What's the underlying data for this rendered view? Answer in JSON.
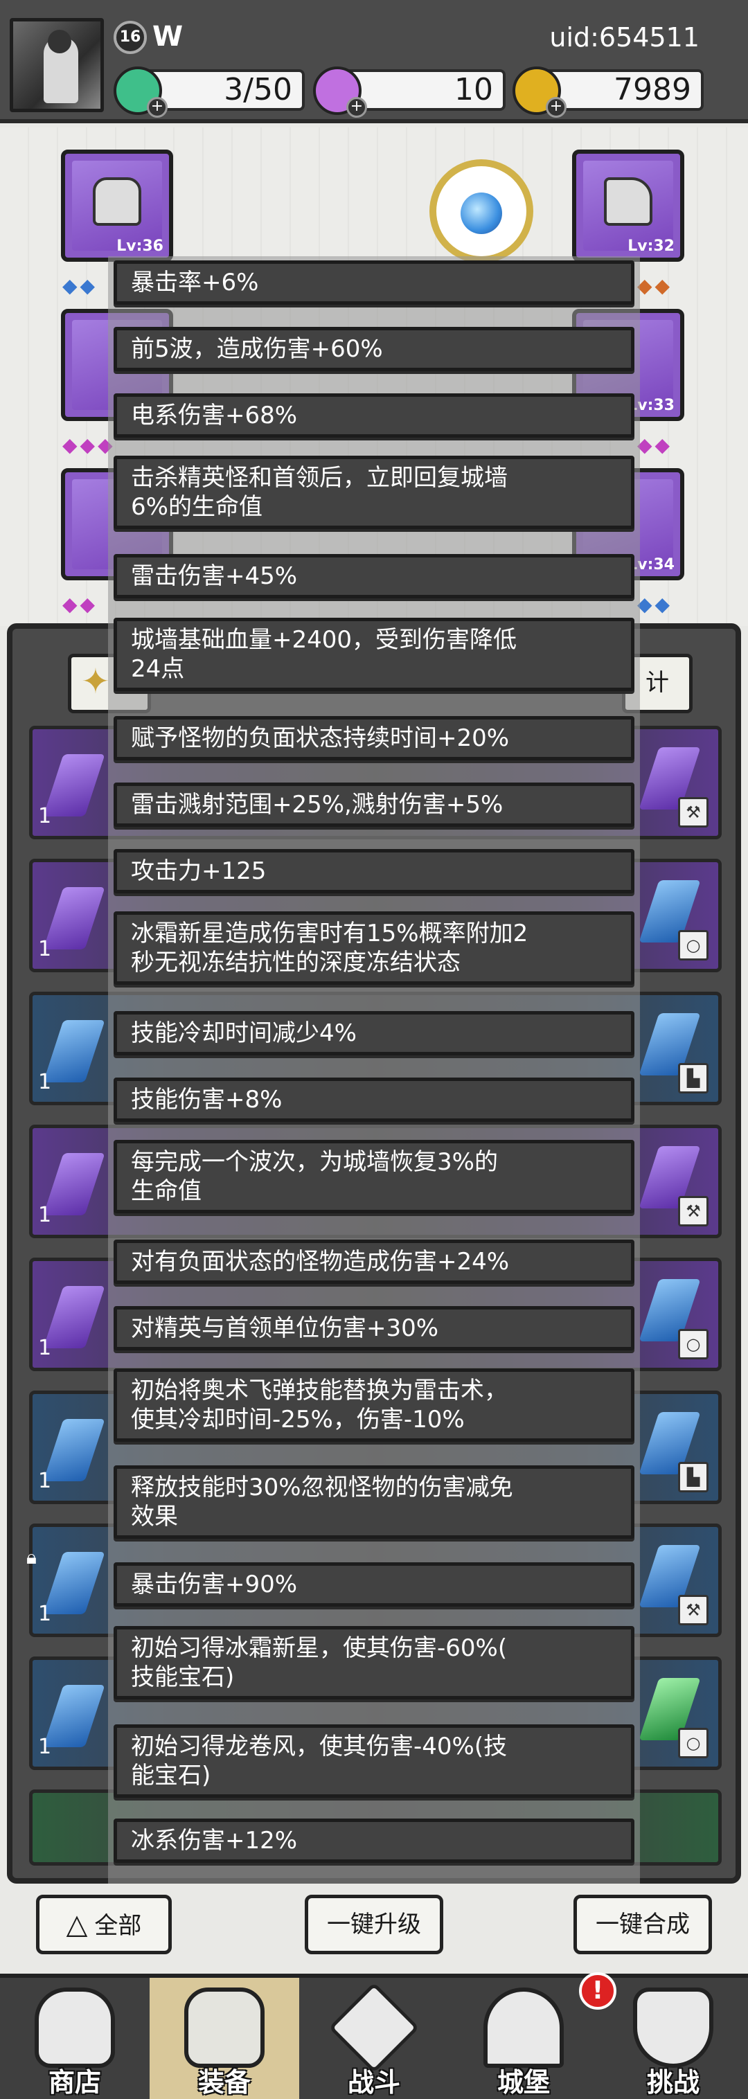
{
  "player": {
    "level": "16",
    "name": "W",
    "uid": "uid:654511"
  },
  "resources": {
    "energy": "3/50",
    "gems": "10",
    "gold": "7989"
  },
  "equipment": {
    "left": [
      {
        "level": "Lv:36"
      }
    ],
    "right": [
      {
        "level": "Lv:32"
      },
      {
        "level": "Lv:33"
      },
      {
        "level": "Lv:34"
      }
    ]
  },
  "inventory": {
    "tab_right_label": "计",
    "rows": [
      {
        "count": "1"
      },
      {
        "count": "1"
      },
      {
        "count": "1"
      },
      {
        "count": "1"
      },
      {
        "count": "1"
      },
      {
        "count": "1"
      },
      {
        "count": "1"
      },
      {
        "count": "1"
      }
    ]
  },
  "attributes": [
    "暴击率+6%",
    "前5波，造成伤害+60%",
    "电系伤害+68%",
    "击杀精英怪和首领后，立即回复城墙\n6%的生命值",
    "雷击伤害+45%",
    "城墙基础血量+2400，受到伤害降低\n24点",
    "赋予怪物的负面状态持续时间+20%",
    "雷击溅射范围+25%,溅射伤害+5%",
    "攻击力+125",
    "冰霜新星造成伤害时有15%概率附加2\n秒无视冻结抗性的深度冻结状态",
    "技能冷却时间减少4%",
    "技能伤害+8%",
    "每完成一个波次，为城墙恢复3%的\n生命值",
    "对有负面状态的怪物造成伤害+24%",
    "对精英与首领单位伤害+30%",
    "初始将奥术飞弹技能替换为雷击术，\n使其冷却时间-25%，伤害-10%",
    "释放技能时30%忽视怪物的伤害减免\n效果",
    "暴击伤害+90%",
    "初始习得冰霜新星，使其伤害-60%(\n技能宝石)",
    "初始习得龙卷风，使其伤害-40%(技\n能宝石)",
    "冰系伤害+12%"
  ],
  "actions": {
    "all_label": "全部",
    "upgrade_all_label": "一键升级",
    "merge_all_label": "一键合成"
  },
  "nav": {
    "shop": "商店",
    "equipment": "装备",
    "battle": "战斗",
    "castle": "城堡",
    "challenge": "挑战",
    "alert": "!"
  },
  "colors": {
    "topbar": "#4b4b4b",
    "energy": "#3fbf8a",
    "gem": "#c070e0",
    "gold": "#e0b020",
    "rare_purple": "#8a5bc8"
  }
}
